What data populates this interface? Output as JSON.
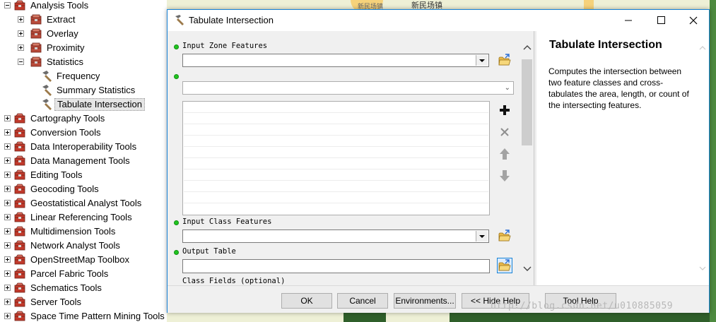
{
  "tree": {
    "items": [
      {
        "label": "Analysis Tools",
        "expander": "minus",
        "icon": "toolbox-icon"
      },
      {
        "label": "Extract",
        "expander": "plus",
        "icon": "toolset-icon"
      },
      {
        "label": "Overlay",
        "expander": "plus",
        "icon": "toolset-icon"
      },
      {
        "label": "Proximity",
        "expander": "plus",
        "icon": "toolset-icon"
      },
      {
        "label": "Statistics",
        "expander": "minus",
        "icon": "toolset-icon"
      },
      {
        "label": "Frequency",
        "expander": "none",
        "icon": "hammer-icon"
      },
      {
        "label": "Summary Statistics",
        "expander": "none",
        "icon": "hammer-icon"
      },
      {
        "label": "Tabulate Intersection",
        "expander": "none",
        "icon": "hammer-icon",
        "selected": true
      },
      {
        "label": "Cartography Tools",
        "expander": "plus",
        "icon": "toolbox-icon"
      },
      {
        "label": "Conversion Tools",
        "expander": "plus",
        "icon": "toolbox-icon"
      },
      {
        "label": "Data Interoperability Tools",
        "expander": "plus",
        "icon": "toolbox-icon"
      },
      {
        "label": "Data Management Tools",
        "expander": "plus",
        "icon": "toolbox-icon"
      },
      {
        "label": "Editing Tools",
        "expander": "plus",
        "icon": "toolbox-icon"
      },
      {
        "label": "Geocoding Tools",
        "expander": "plus",
        "icon": "toolbox-icon"
      },
      {
        "label": "Geostatistical Analyst Tools",
        "expander": "plus",
        "icon": "toolbox-icon"
      },
      {
        "label": "Linear Referencing Tools",
        "expander": "plus",
        "icon": "toolbox-icon"
      },
      {
        "label": "Multidimension Tools",
        "expander": "plus",
        "icon": "toolbox-icon"
      },
      {
        "label": "Network Analyst Tools",
        "expander": "plus",
        "icon": "toolbox-icon"
      },
      {
        "label": "OpenStreetMap Toolbox",
        "expander": "plus",
        "icon": "toolbox-icon"
      },
      {
        "label": "Parcel Fabric Tools",
        "expander": "plus",
        "icon": "toolbox-icon"
      },
      {
        "label": "Schematics Tools",
        "expander": "plus",
        "icon": "toolbox-icon"
      },
      {
        "label": "Server Tools",
        "expander": "plus",
        "icon": "toolbox-icon"
      },
      {
        "label": "Space Time Pattern Mining Tools",
        "expander": "plus",
        "icon": "toolbox-icon"
      }
    ]
  },
  "map": {
    "place_label": "新民场镇",
    "small_label": "新民场镇"
  },
  "dialog": {
    "title": "Tabulate Intersection",
    "params": {
      "input_zone_label": "Input Zone Features",
      "input_class_label": "Input Class Features",
      "output_table_label": "Output Table",
      "class_fields_label": "Class Fields (optional)",
      "input_zone_value": "",
      "zone_field_value": "",
      "input_class_value": "",
      "output_table_value": ""
    },
    "help": {
      "title": "Tabulate Intersection",
      "body": "Computes the intersection between two feature classes and cross-tabulates the area, length, or count of the intersecting features."
    },
    "buttons": {
      "ok": "OK",
      "cancel": "Cancel",
      "environments": "Environments...",
      "hide_help": "<< Hide Help",
      "tool_help": "Tool Help"
    }
  },
  "watermark": "http://blog.csdn.net/u010885059"
}
